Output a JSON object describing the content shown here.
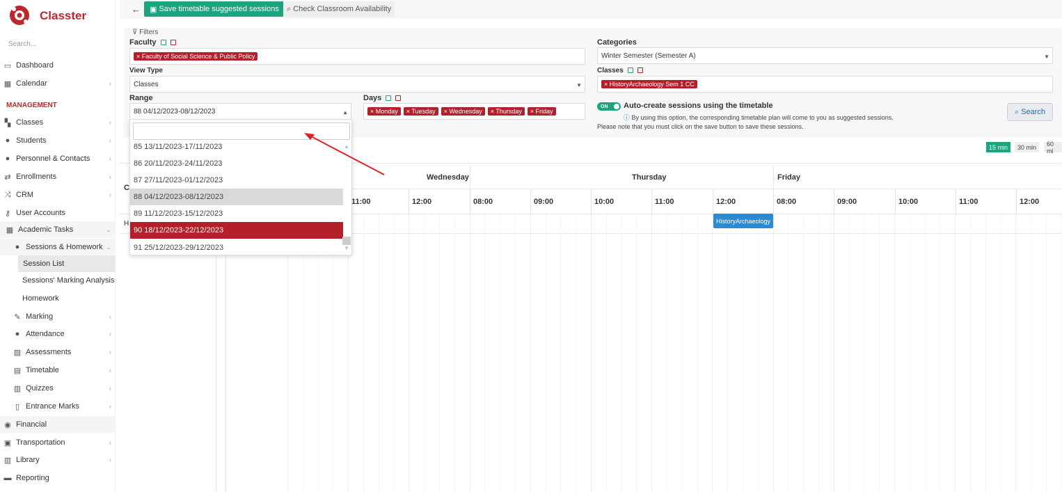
{
  "app": {
    "name": "Classter",
    "brand_color": "#c0272d"
  },
  "sidebar": {
    "search_placeholder": "Search...",
    "section_management": "MANAGEMENT",
    "items": [
      {
        "label": "Dashboard",
        "icon": "laptop-icon"
      },
      {
        "label": "Calendar",
        "icon": "calendar-icon"
      },
      {
        "label": "Classes",
        "icon": "classes-icon"
      },
      {
        "label": "Students",
        "icon": "students-icon"
      },
      {
        "label": "Personnel & Contacts",
        "icon": "person-icon"
      },
      {
        "label": "Enrollments",
        "icon": "exchange-icon"
      },
      {
        "label": "CRM",
        "icon": "crm-icon"
      },
      {
        "label": "User Accounts",
        "icon": "key-icon"
      },
      {
        "label": "Academic Tasks",
        "icon": "grid-icon"
      },
      {
        "label": "Sessions & Homework",
        "icon": "sessions-icon"
      },
      {
        "label": "Session List"
      },
      {
        "label": "Sessions' Marking Analysis"
      },
      {
        "label": "Homework"
      },
      {
        "label": "Marking",
        "icon": "edit-icon"
      },
      {
        "label": "Attendance",
        "icon": "attendance-icon"
      },
      {
        "label": "Assessments",
        "icon": "assessment-icon"
      },
      {
        "label": "Timetable",
        "icon": "timetable-icon"
      },
      {
        "label": "Quizzes",
        "icon": "quiz-icon"
      },
      {
        "label": "Entrance Marks",
        "icon": "clipboard-icon"
      },
      {
        "label": "Financial",
        "icon": "coins-icon"
      },
      {
        "label": "Transportation",
        "icon": "bus-icon"
      },
      {
        "label": "Library",
        "icon": "books-icon"
      },
      {
        "label": "Reporting",
        "icon": "printer-icon"
      }
    ]
  },
  "toolbar": {
    "save_label": "Save timetable suggested sessions",
    "check_label": "Check Classroom Availability"
  },
  "filters": {
    "title": "Filters",
    "faculty_label": "Faculty",
    "faculty_tag": "Faculty of Social Science & Public Policy",
    "view_type_label": "View Type",
    "view_type_value": "Classes",
    "range_label": "Range",
    "range_value": "88 04/12/2023-08/12/2023",
    "days_label": "Days",
    "days": [
      "Monday",
      "Tuesday",
      "Wednesday",
      "Thursday",
      "Friday"
    ],
    "categories_label": "Categories",
    "categories_value": "Winter Semester (Semester A)",
    "classes_label": "Classes",
    "classes_tag": "HistoryArchaeology Sem 1 CC",
    "toggle_label": "ON",
    "auto_create_label": "Auto-create sessions using the timetable",
    "auto_create_info": "By using this option, the corresponding timetable plan will come to you as suggested sessions.",
    "auto_create_note": "Please note that you must click on the save button to save these sessions.",
    "search_label": "Search"
  },
  "calendar": {
    "zoom": [
      "15 min",
      "30 min",
      "60 mi"
    ],
    "days": [
      "Wednesday",
      "Thursday",
      "Friday"
    ],
    "hours_wed": [
      "11:00",
      "12:00"
    ],
    "hours_thu": [
      "08:00",
      "09:00",
      "10:00",
      "11:00",
      "12:00"
    ],
    "hours_fri": [
      "08:00",
      "09:00",
      "10:00",
      "11:00",
      "12:00"
    ],
    "left_header_initial": "C",
    "row_initial": "H",
    "event_label": "HistoryArchaeology"
  },
  "dropdown": {
    "options": [
      "85 13/11/2023-17/11/2023",
      "86 20/11/2023-24/11/2023",
      "87 27/11/2023-01/12/2023",
      "88 04/12/2023-08/12/2023",
      "89 11/12/2023-15/12/2023",
      "90 18/12/2023-22/12/2023",
      "91 25/12/2023-29/12/2023"
    ]
  }
}
